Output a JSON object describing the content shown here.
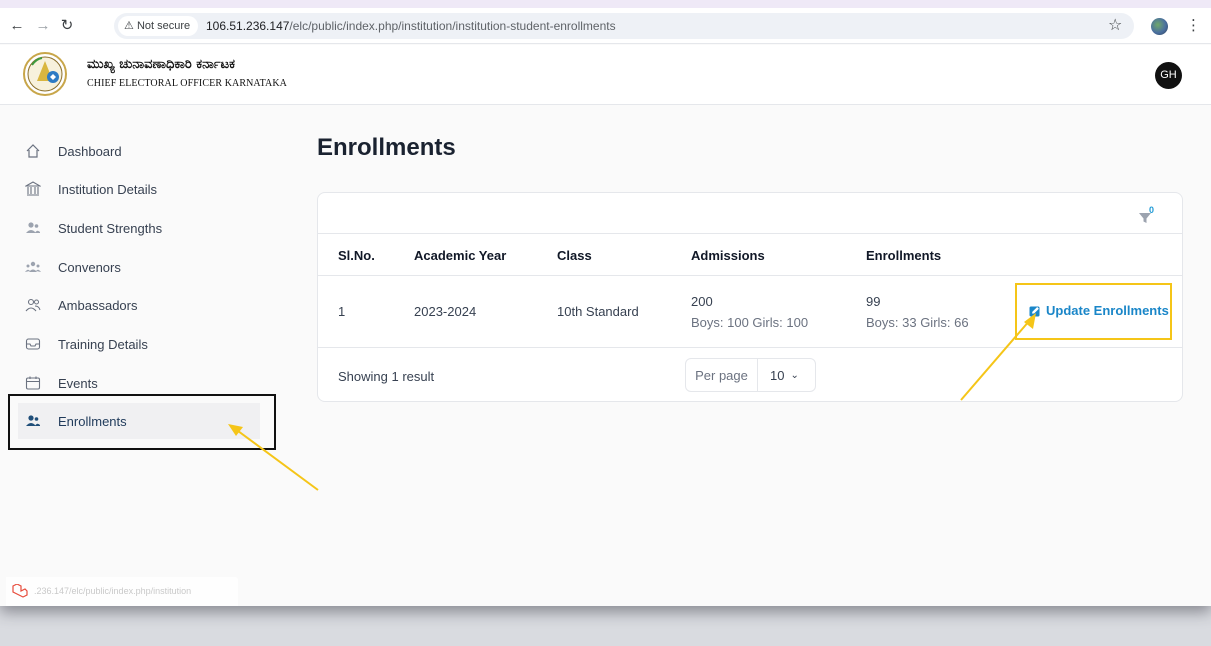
{
  "browser": {
    "security_label": "Not secure",
    "url_host": "106.51.236.147",
    "url_path": "/elc/public/index.php/institution/institution-student-enrollments",
    "nav_icons": [
      "back-icon",
      "forward-icon",
      "reload-icon"
    ]
  },
  "header": {
    "brand_kannada": "ಮುಖ್ಯ ಚುನಾವಣಾಧಿಕಾರಿ ಕರ್ನಾಟಕ",
    "brand_english": "CHIEF ELECTORAL OFFICER KARNATAKA",
    "user_initials": "GH"
  },
  "sidebar": {
    "items": [
      {
        "label": "Dashboard",
        "icon": "home-icon"
      },
      {
        "label": "Institution Details",
        "icon": "institution-icon"
      },
      {
        "label": "Student Strengths",
        "icon": "users-icon"
      },
      {
        "label": "Convenors",
        "icon": "user-group-icon"
      },
      {
        "label": "Ambassadors",
        "icon": "people-icon"
      },
      {
        "label": "Training Details",
        "icon": "tray-icon"
      },
      {
        "label": "Events",
        "icon": "calendar-icon"
      },
      {
        "label": "Enrollments",
        "icon": "users-icon",
        "active": true
      }
    ]
  },
  "main": {
    "title": "Enrollments",
    "filter_count": "0",
    "table": {
      "columns": [
        "Sl.No.",
        "Academic Year",
        "Class",
        "Admissions",
        "Enrollments"
      ],
      "rows": [
        {
          "sl_no": "1",
          "academic_year": "2023-2024",
          "class": "10th Standard",
          "admissions": "200",
          "admissions_detail": "Boys: 100 Girls: 100",
          "enrollments": "99",
          "enrollments_detail": "Boys: 33 Girls: 66",
          "action_label": "Update Enrollments"
        }
      ]
    },
    "footer": {
      "showing": "Showing 1 result",
      "per_page_label": "Per page",
      "per_page_value": "10"
    }
  },
  "status_bar": {
    "url": ".236.147/elc/public/index.php/institution"
  },
  "colors": {
    "accent_link": "#1a86c8",
    "highlight_yellow": "#f5c518",
    "avatar_bg": "#111111"
  }
}
